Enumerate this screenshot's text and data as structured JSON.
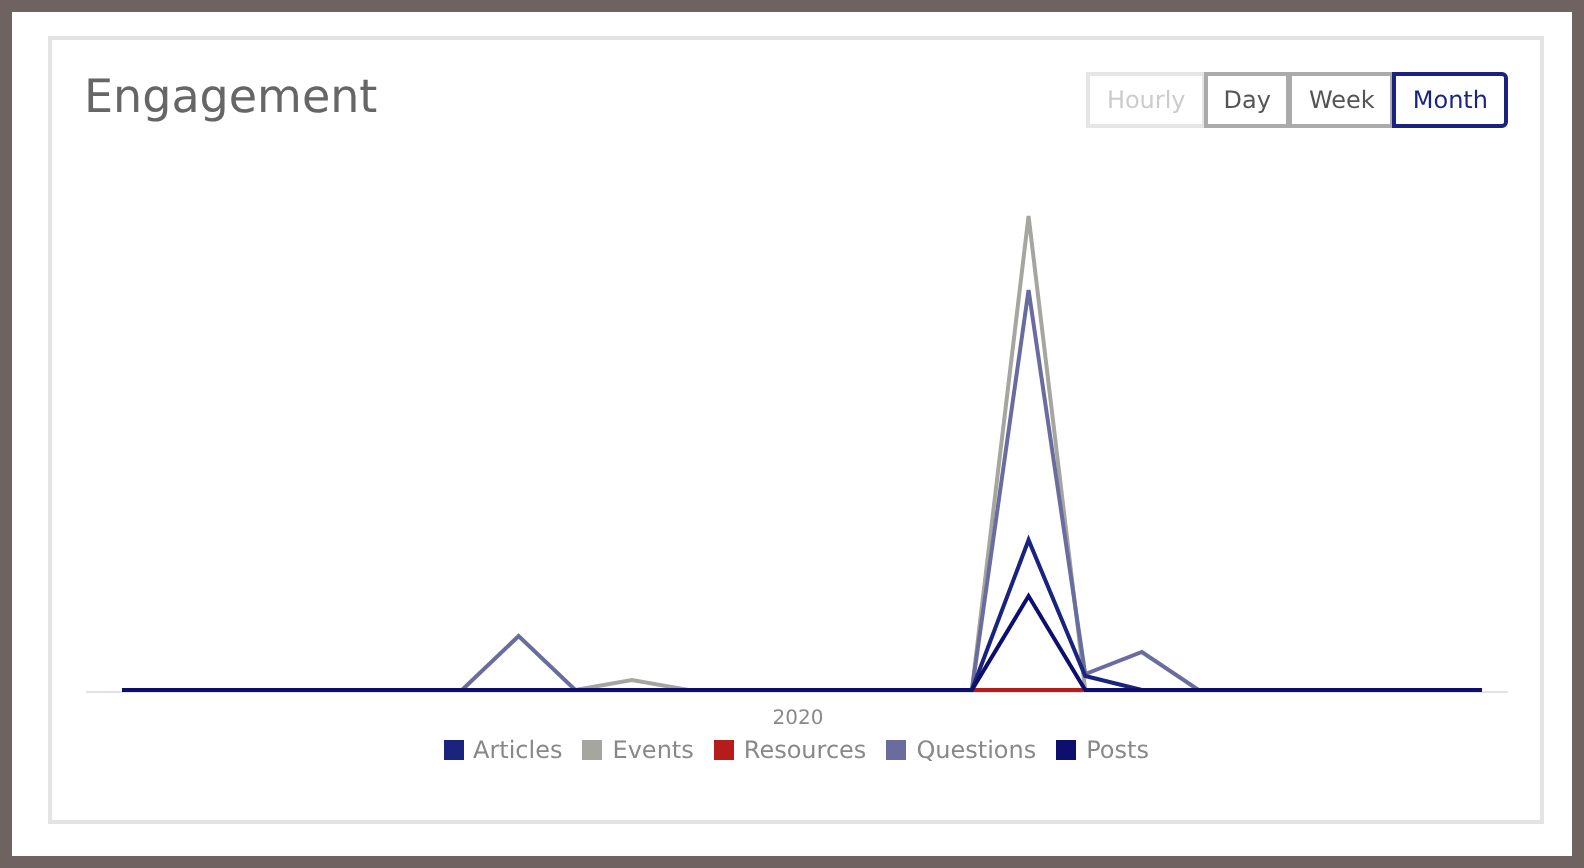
{
  "card": {
    "title": "Engagement"
  },
  "range_buttons": [
    {
      "label": "Hourly",
      "selected": false,
      "disabled": true
    },
    {
      "label": "Day",
      "selected": false,
      "disabled": false
    },
    {
      "label": "Week",
      "selected": false,
      "disabled": false
    },
    {
      "label": "Month",
      "selected": true,
      "disabled": false
    }
  ],
  "chart": {
    "x_label": "2020",
    "legend": [
      {
        "label": "Articles",
        "color": "#1a237e"
      },
      {
        "label": "Events",
        "color": "#a5a69f"
      },
      {
        "label": "Resources",
        "color": "#b71c1c"
      },
      {
        "label": "Questions",
        "color": "#6a6c9e"
      },
      {
        "label": "Posts",
        "color": "#0d0f6e"
      }
    ]
  }
}
